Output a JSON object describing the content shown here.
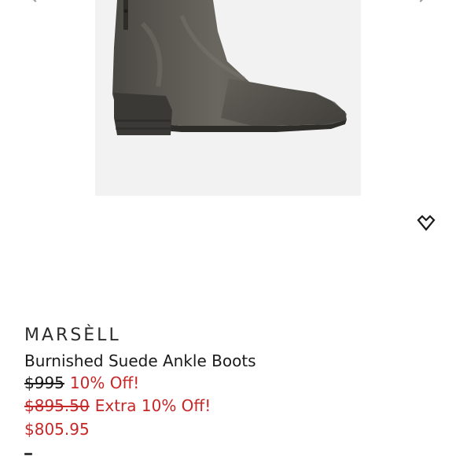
{
  "product": {
    "brand": "MARSÈLL",
    "name": "Burnished Suede Ankle Boots",
    "original_price": "$995",
    "first_discount": "10% Off!",
    "discounted_price": "$895.50",
    "extra_discount": "Extra 10% Off!",
    "final_price": "$805.95"
  },
  "icons": {
    "carousel_prev": "chevron-left-icon",
    "carousel_next": "chevron-right-icon",
    "wishlist": "heart-diamond-icon"
  },
  "colors": {
    "sale_red": "#c62828",
    "text_dark": "#1a1a1a",
    "image_bg": "#f2f2f2"
  }
}
